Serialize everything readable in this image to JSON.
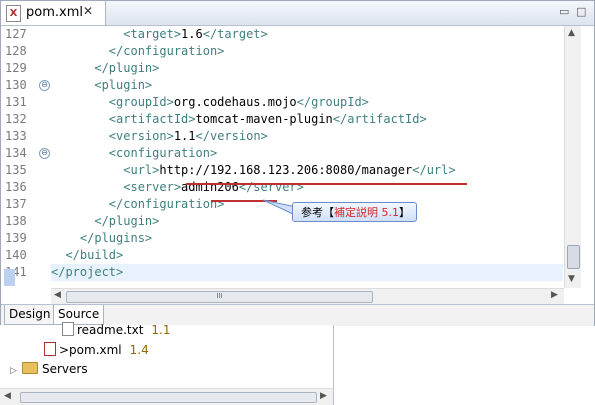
{
  "editor": {
    "tab_title": "pom.xml",
    "tab_close": "✕",
    "tab_icon": "X",
    "win_minimize": "▭",
    "win_maximize": "□"
  },
  "line_numbers": [
    "127",
    "128",
    "129",
    "130",
    "131",
    "132",
    "133",
    "134",
    "135",
    "136",
    "137",
    "138",
    "139",
    "140",
    "141"
  ],
  "fold_marker": "⊖",
  "code_lines": [
    {
      "indent": "          ",
      "tokens": [
        {
          "t": "<target>",
          "tag": true
        },
        {
          "t": "1.6"
        },
        {
          "t": "</target>",
          "tag": true
        }
      ]
    },
    {
      "indent": "        ",
      "tokens": [
        {
          "t": "</configuration>",
          "tag": true
        }
      ]
    },
    {
      "indent": "      ",
      "tokens": [
        {
          "t": "</plugin>",
          "tag": true
        }
      ]
    },
    {
      "indent": "      ",
      "tokens": [
        {
          "t": "<plugin>",
          "tag": true
        }
      ]
    },
    {
      "indent": "        ",
      "tokens": [
        {
          "t": "<groupId>",
          "tag": true
        },
        {
          "t": "org.codehaus.mojo"
        },
        {
          "t": "</groupId>",
          "tag": true
        }
      ]
    },
    {
      "indent": "        ",
      "tokens": [
        {
          "t": "<artifactId>",
          "tag": true
        },
        {
          "t": "tomcat-maven-plugin"
        },
        {
          "t": "</artifactId>",
          "tag": true
        }
      ]
    },
    {
      "indent": "        ",
      "tokens": [
        {
          "t": "<version>",
          "tag": true
        },
        {
          "t": "1.1"
        },
        {
          "t": "</version>",
          "tag": true
        }
      ]
    },
    {
      "indent": "        ",
      "tokens": [
        {
          "t": "<configuration>",
          "tag": true
        }
      ]
    },
    {
      "indent": "          ",
      "tokens": [
        {
          "t": "<url>",
          "tag": true
        },
        {
          "t": "http://192.168.123.206:8080/manager"
        },
        {
          "t": "</url>",
          "tag": true
        }
      ]
    },
    {
      "indent": "          ",
      "tokens": [
        {
          "t": "<server>",
          "tag": true
        },
        {
          "t": "admin206"
        },
        {
          "t": "</server>",
          "tag": true
        }
      ]
    },
    {
      "indent": "        ",
      "tokens": [
        {
          "t": "</configuration>",
          "tag": true
        }
      ]
    },
    {
      "indent": "      ",
      "tokens": [
        {
          "t": "</plugin>",
          "tag": true
        }
      ]
    },
    {
      "indent": "    ",
      "tokens": [
        {
          "t": "</plugins>",
          "tag": true
        }
      ]
    },
    {
      "indent": "  ",
      "tokens": [
        {
          "t": "</build>",
          "tag": true
        }
      ]
    },
    {
      "indent": "",
      "tokens": [
        {
          "t": "</project>",
          "tag": true
        }
      ]
    }
  ],
  "callout": {
    "prefix": "参考【",
    "highlight": "補定説明 5.1",
    "suffix": "】"
  },
  "bottom_tabs": {
    "design": "Design",
    "source": "Source",
    "active": "Source"
  },
  "scroll": {
    "h_thumb_grip": "III",
    "v_thumb_grip": "≡",
    "up": "▲",
    "down": "▼",
    "left": "◀",
    "right": "▶"
  },
  "explorer": {
    "items": [
      {
        "name": "readme.txt",
        "version": "1.1"
      },
      {
        "name": ">pom.xml",
        "version": "1.4"
      },
      {
        "name": "Servers",
        "version": ""
      }
    ],
    "expander": "▷"
  },
  "colors": {
    "tag": "#3f7f7f",
    "annotation": "#c03030",
    "callout_highlight": "#d22a2a"
  }
}
